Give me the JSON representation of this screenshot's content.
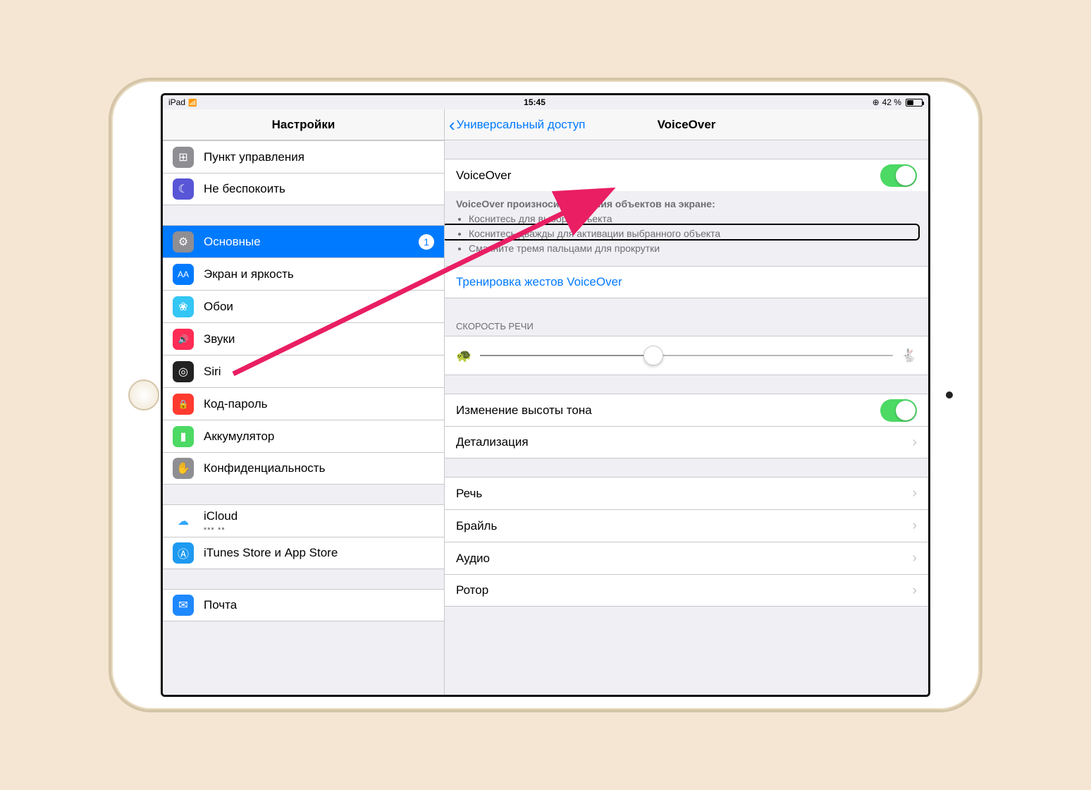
{
  "statusBar": {
    "device": "iPad",
    "time": "15:45",
    "batteryPct": "42 %",
    "batteryFill": 42,
    "lockGlyph": "⊕"
  },
  "sidebar": {
    "title": "Настройки",
    "groups": [
      {
        "items": [
          {
            "key": "control-center",
            "label": "Пункт управления",
            "iconBg": "#8e8e93",
            "iconGlyph": "⊞"
          },
          {
            "key": "dnd",
            "label": "Не беспокоить",
            "iconBg": "#5856d6",
            "iconGlyph": "☾"
          }
        ]
      },
      {
        "items": [
          {
            "key": "general",
            "label": "Основные",
            "iconBg": "#8e8e93",
            "iconGlyph": "⚙",
            "selected": true,
            "badge": "1"
          },
          {
            "key": "display",
            "label": "Экран и яркость",
            "iconBg": "#007aff",
            "iconGlyph": "AA"
          },
          {
            "key": "wallpaper",
            "label": "Обои",
            "iconBg": "#34c6f4",
            "iconGlyph": "❀"
          },
          {
            "key": "sounds",
            "label": "Звуки",
            "iconBg": "#ff2d55",
            "iconGlyph": "🔊"
          },
          {
            "key": "siri",
            "label": "Siri",
            "iconBg": "#222",
            "iconGlyph": "◎"
          },
          {
            "key": "passcode",
            "label": "Код-пароль",
            "iconBg": "#ff3b30",
            "iconGlyph": "🔒"
          },
          {
            "key": "battery",
            "label": "Аккумулятор",
            "iconBg": "#4cd964",
            "iconGlyph": "▮"
          },
          {
            "key": "privacy",
            "label": "Конфиденциальность",
            "iconBg": "#8e8e93",
            "iconGlyph": "✋"
          }
        ]
      },
      {
        "items": [
          {
            "key": "icloud",
            "label": "iCloud",
            "iconBg": "#fff",
            "iconGlyph": "☁",
            "iconFg": "#2ea7ff",
            "sub": "▪▪▪ ▪▪"
          },
          {
            "key": "stores",
            "label": "iTunes Store и App Store",
            "iconBg": "#1e9af1",
            "iconGlyph": "Ⓐ"
          }
        ]
      },
      {
        "items": [
          {
            "key": "mail",
            "label": "Почта",
            "iconBg": "#1e88ff",
            "iconGlyph": "✉"
          }
        ]
      }
    ]
  },
  "detail": {
    "backLabel": "Универсальный доступ",
    "title": "VoiceOver",
    "voiceover": {
      "rowLabel": "VoiceOver",
      "enabled": true,
      "desc": {
        "heading": "VoiceOver произносит названия объектов на экране:",
        "bullets": [
          "Коснитесь для выбора объекта",
          "Коснитесь дважды для активации выбранного объекта",
          "Смахните тремя пальцами для прокрутки"
        ]
      }
    },
    "practice": {
      "label": "Тренировка жестов VoiceOver"
    },
    "speed": {
      "header": "СКОРОСТЬ РЕЧИ",
      "value": 42
    },
    "pitch": {
      "label": "Изменение высоты тона",
      "enabled": true
    },
    "verbosity": {
      "label": "Детализация"
    },
    "rows": {
      "speech": "Речь",
      "braille": "Брайль",
      "audio": "Аудио",
      "rotor": "Ротор"
    }
  },
  "colors": {
    "accent": "#007aff",
    "green": "#4cd964",
    "arrow": "#e91e63"
  }
}
